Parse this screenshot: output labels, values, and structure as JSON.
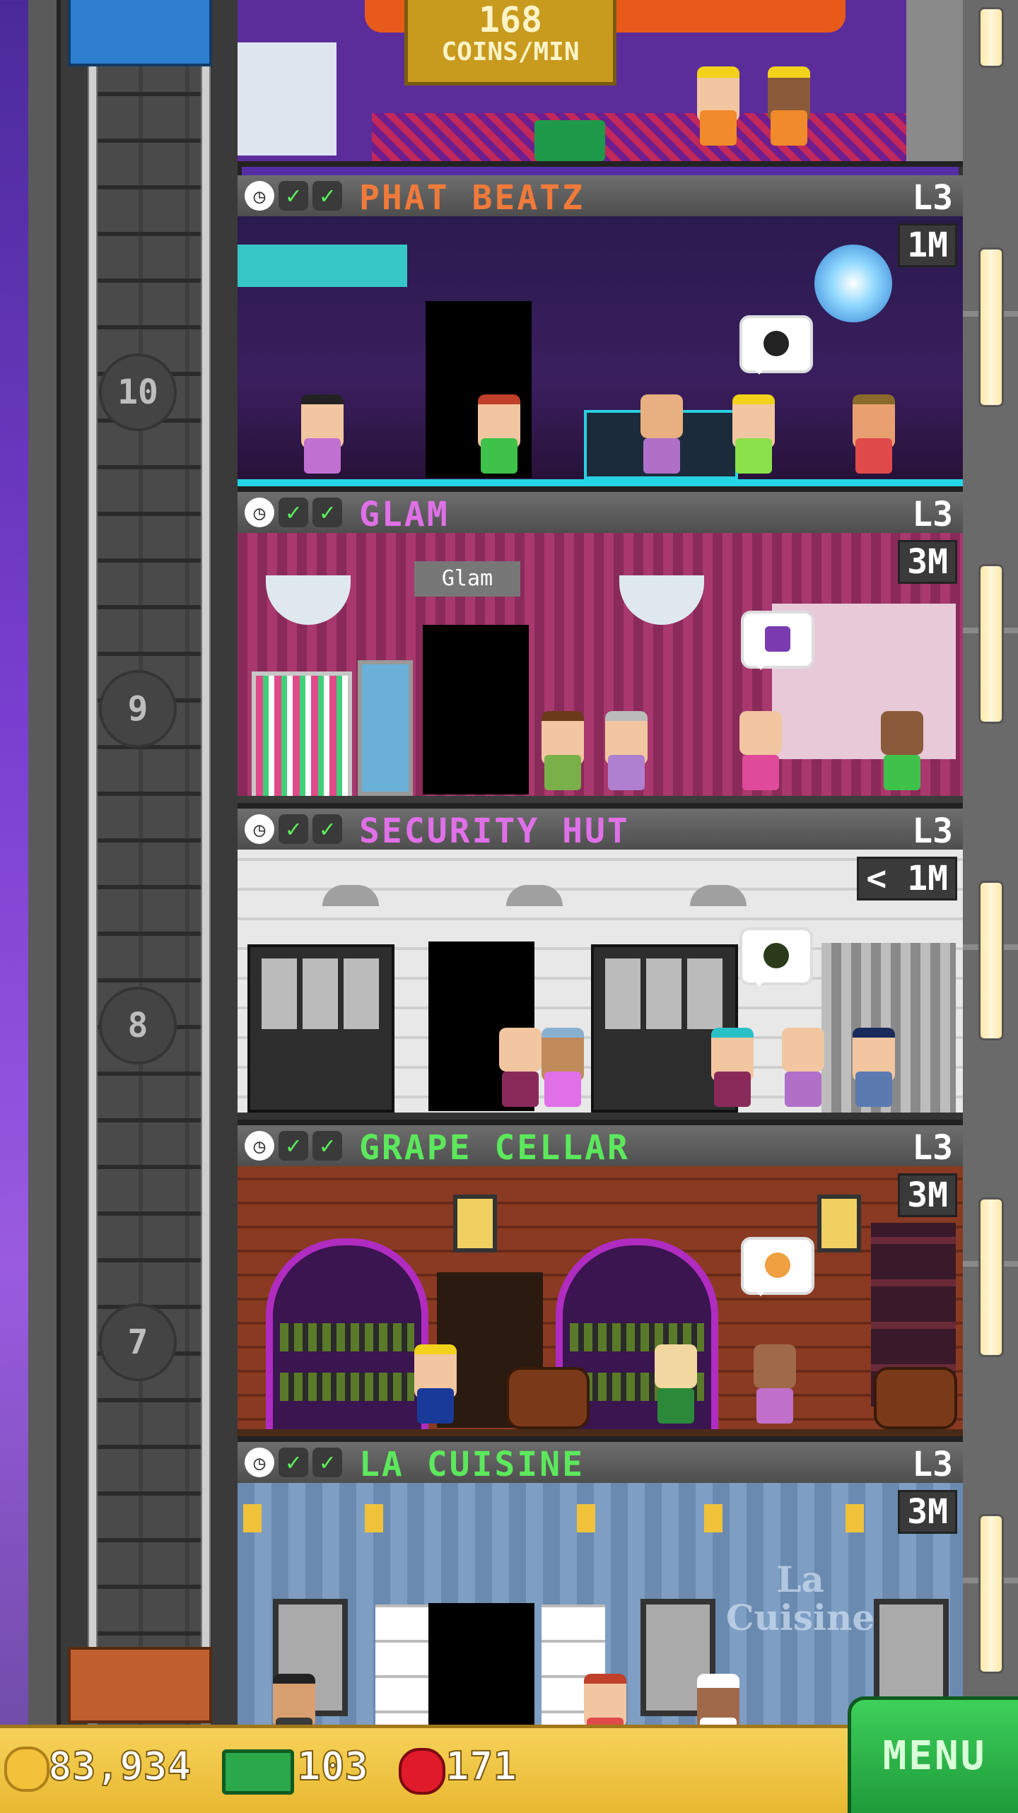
{
  "top_floor": {
    "coins_rate_value": "168",
    "coins_rate_unit": "COINS/MIN"
  },
  "shaft_floor_numbers": [
    "10",
    "9",
    "8",
    "7"
  ],
  "floors": [
    {
      "name": "PHAT BEATZ",
      "level": "L3",
      "timer": "1M",
      "name_color": "#f07a3a"
    },
    {
      "name": "GLAM",
      "level": "L3",
      "timer": "3M",
      "name_color": "#e070e8"
    },
    {
      "name": "SECURITY HUT",
      "level": "L3",
      "timer": "< 1M",
      "name_color": "#e070e8"
    },
    {
      "name": "GRAPE CELLAR",
      "level": "L3",
      "timer": "3M",
      "name_color": "#5ce85c"
    },
    {
      "name": "LA CUISINE",
      "level": "L3",
      "timer": "3M",
      "name_color": "#5ce85c"
    }
  ],
  "glam_sign": "Glam",
  "cuisine_sign": "La Cuisine",
  "status_icons": [
    "clock-icon",
    "check-icon",
    "check-icon"
  ],
  "bottom_bar": {
    "coins": "83,934",
    "bux": "103",
    "gems": "171"
  },
  "menu_label": "MENU"
}
